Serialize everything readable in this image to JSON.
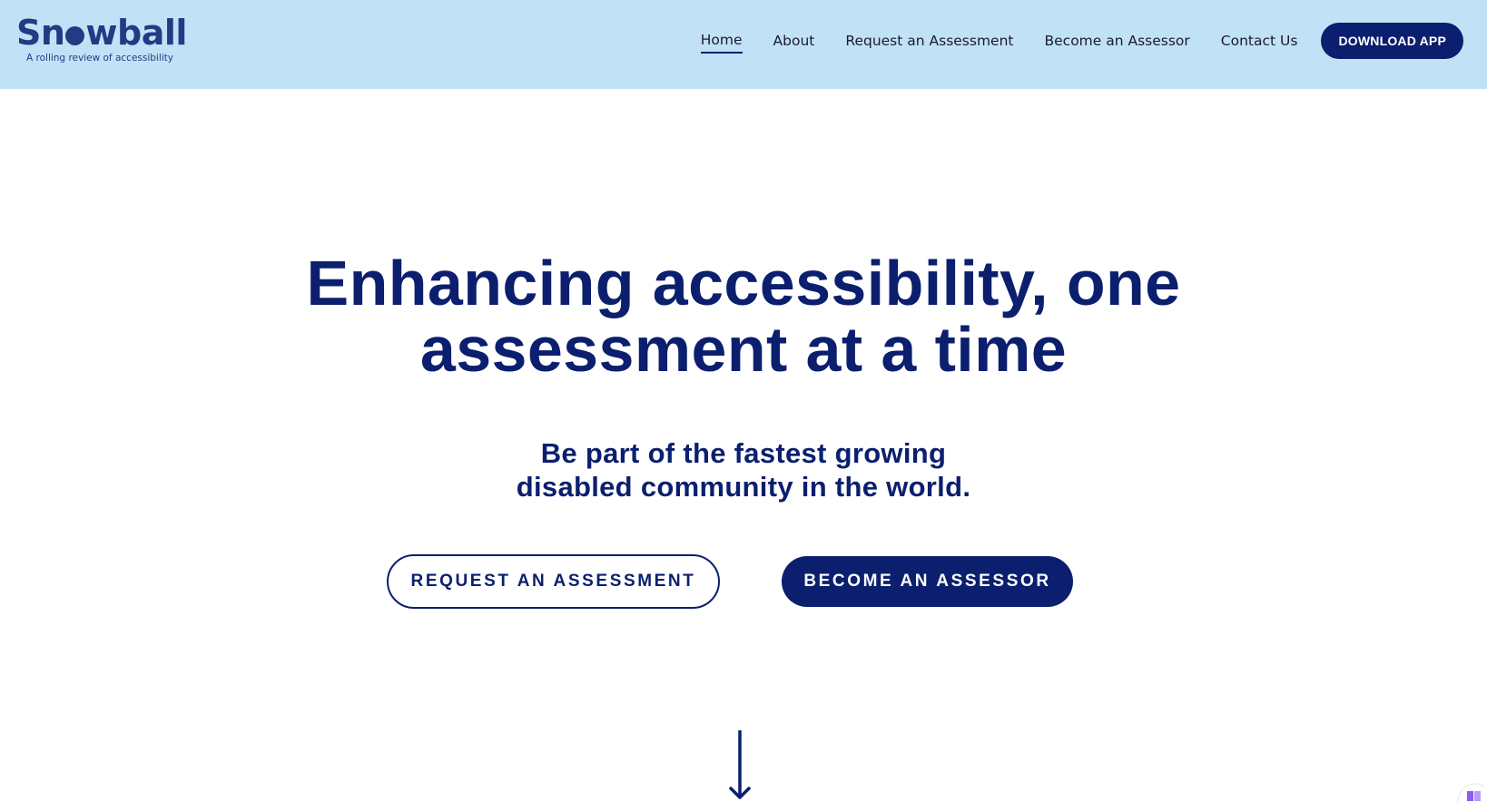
{
  "header": {
    "logo": {
      "word_before": "Sn",
      "word_after": "wball",
      "tagline": "A rolling review of accessibility"
    },
    "nav": [
      {
        "label": "Home",
        "active": true
      },
      {
        "label": "About",
        "active": false
      },
      {
        "label": "Request an Assessment",
        "active": false
      },
      {
        "label": "Become an Assessor",
        "active": false
      },
      {
        "label": "Contact Us",
        "active": false
      }
    ],
    "download_label": "DOWNLOAD APP"
  },
  "hero": {
    "title_line1": "Enhancing accessibility, one",
    "title_line2": "assessment at a time",
    "subtitle_line1": "Be part of the fastest growing",
    "subtitle_line2": "disabled community in the world.",
    "cta_primary": "REQUEST AN ASSESSMENT",
    "cta_secondary": "BECOME AN ASSESSOR"
  },
  "icons": {
    "scroll": "arrow-down-icon",
    "reader": "book-icon"
  },
  "colors": {
    "header_bg": "#c1e2f6",
    "brand_navy": "#0b1f6e",
    "logo_blue": "#233a84",
    "reader_purple": "#8a5cf6"
  }
}
